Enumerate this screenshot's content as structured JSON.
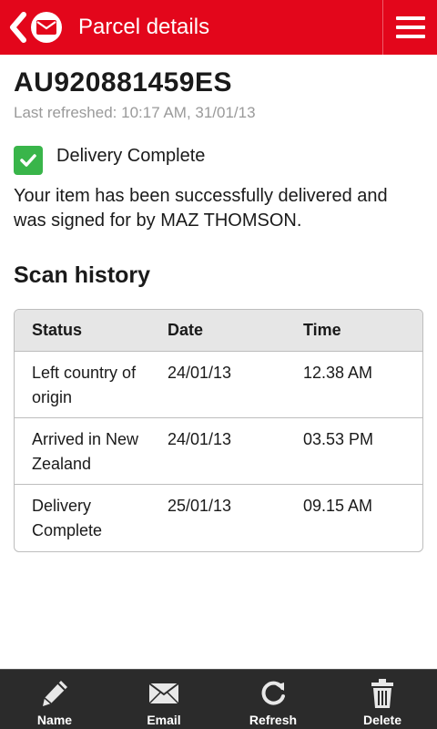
{
  "header": {
    "title": "Parcel details",
    "back_icon": "chevron-left-icon",
    "logo_icon": "envelope-logo-icon",
    "menu_icon": "hamburger-menu-icon",
    "background_color": "#e3061b"
  },
  "parcel": {
    "tracking_number": "AU920881459ES",
    "last_refreshed": "Last refreshed: 10:17 AM, 31/01/13",
    "status": "Delivery Complete",
    "status_icon": "checkmark-icon",
    "status_color": "#39b54a",
    "message": "Your item has been successfully delivered and was signed for by MAZ THOMSON."
  },
  "scan_history": {
    "title": "Scan history",
    "columns": [
      "Status",
      "Date",
      "Time"
    ],
    "rows": [
      {
        "status": "Left country of origin",
        "date": "24/01/13",
        "time": "12.38 AM"
      },
      {
        "status": "Arrived in New Zealand",
        "date": "24/01/13",
        "time": "03.53 PM"
      },
      {
        "status": "Delivery Complete",
        "date": "25/01/13",
        "time": "09.15 AM"
      }
    ]
  },
  "bottom_bar": {
    "items": [
      {
        "label": "Name",
        "icon": "pencil-icon"
      },
      {
        "label": "Email",
        "icon": "envelope-icon"
      },
      {
        "label": "Refresh",
        "icon": "refresh-icon"
      },
      {
        "label": "Delete",
        "icon": "trash-icon"
      }
    ]
  }
}
